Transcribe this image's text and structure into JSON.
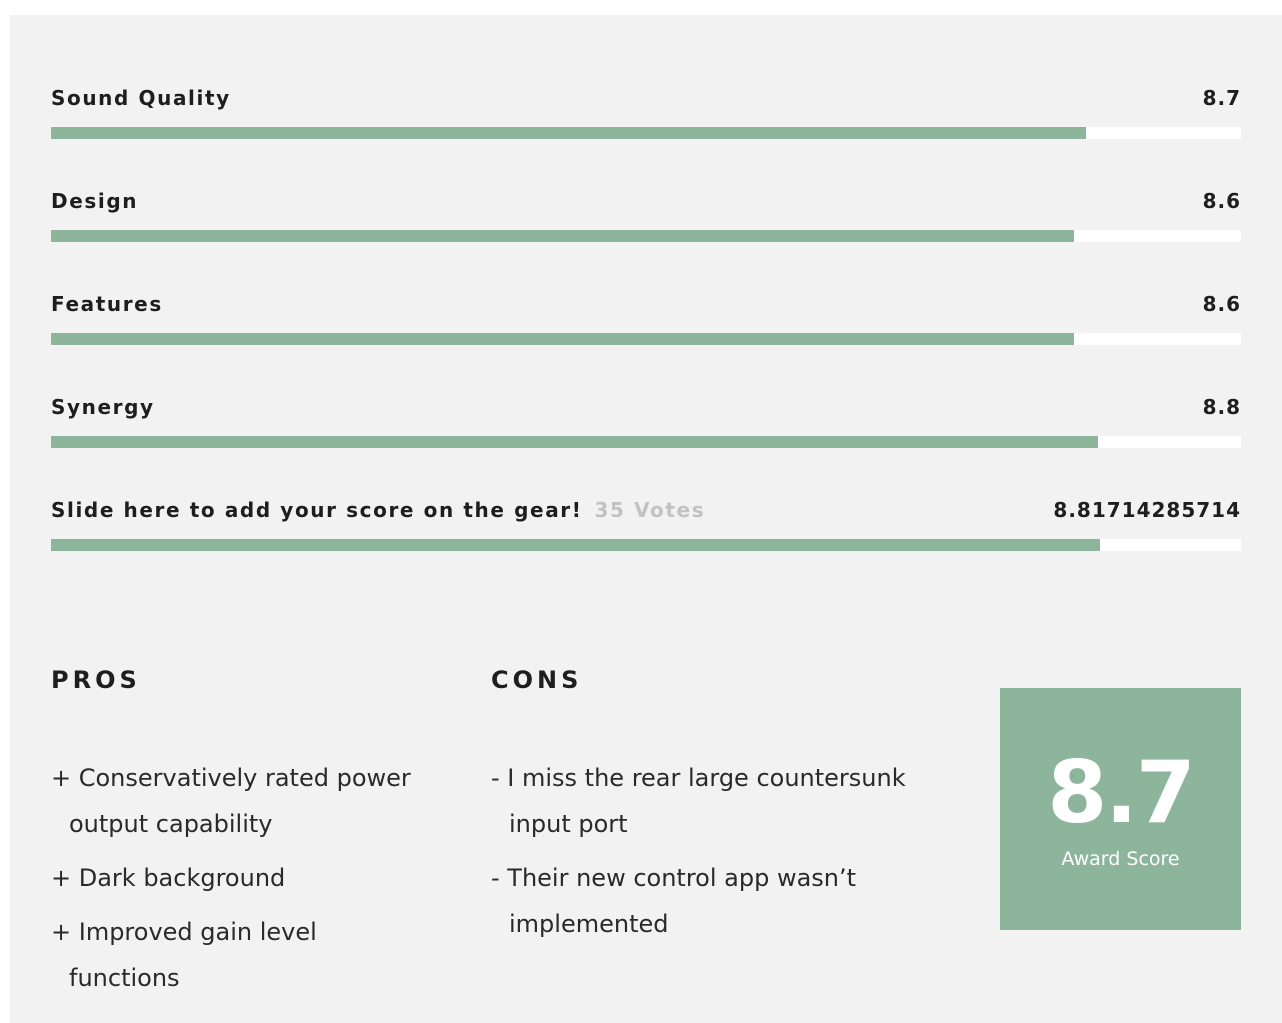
{
  "ratings": [
    {
      "label": "Sound Quality",
      "value": "8.7",
      "fill_fraction": 0.87
    },
    {
      "label": "Design",
      "value": "8.6",
      "fill_fraction": 0.86
    },
    {
      "label": "Features",
      "value": "8.6",
      "fill_fraction": 0.86
    },
    {
      "label": "Synergy",
      "value": "8.8",
      "fill_fraction": 0.88
    }
  ],
  "user_rating": {
    "label": "Slide here to add your score on the gear!",
    "votes": "35 Votes",
    "value": "8.81714285714",
    "fill_fraction": 0.8817
  },
  "pros": {
    "title": "PROS",
    "items": [
      "+ Conservatively rated power output capability",
      "+ Dark background",
      "+ Improved gain level functions"
    ]
  },
  "cons": {
    "title": "CONS",
    "items": [
      "- I miss the rear large countersunk input port",
      "- Their new control app wasn’t implemented"
    ]
  },
  "award": {
    "score": "8.7",
    "label": "Award Score"
  },
  "colors": {
    "accent": "#8db59c",
    "track": "#ffffff",
    "panel": "#f2f2f2",
    "votes_text": "#c2c2c2"
  }
}
